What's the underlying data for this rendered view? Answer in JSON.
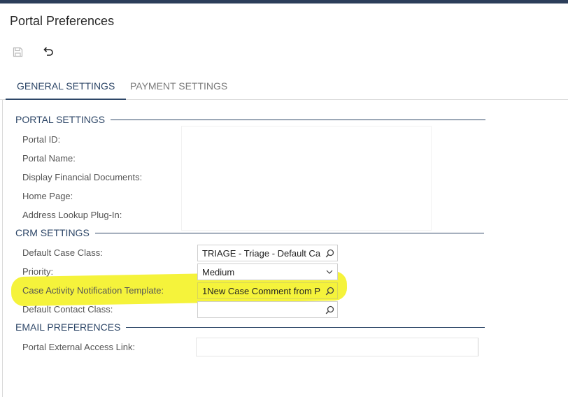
{
  "page": {
    "title": "Portal Preferences"
  },
  "toolbar": {
    "save_icon": "save-icon",
    "undo_icon": "undo-icon"
  },
  "tabs": [
    {
      "label": "GENERAL SETTINGS",
      "active": true
    },
    {
      "label": "PAYMENT SETTINGS",
      "active": false
    }
  ],
  "portal_settings": {
    "heading": "PORTAL SETTINGS",
    "labels": {
      "portal_id": "Portal ID:",
      "portal_name": "Portal Name:",
      "display_financial_documents": "Display Financial Documents:",
      "home_page": "Home Page:",
      "address_lookup_plugin": "Address Lookup Plug-In:"
    }
  },
  "crm_settings": {
    "heading": "CRM SETTINGS",
    "default_case_class": {
      "label": "Default Case Class:",
      "value": "TRIAGE - Triage - Default Ca"
    },
    "priority": {
      "label": "Priority:",
      "value": "Medium"
    },
    "case_activity_notification_template": {
      "label": "Case Activity Notification Template:",
      "value": "1New Case Comment from P"
    },
    "default_contact_class": {
      "label": "Default Contact Class:",
      "value": ""
    }
  },
  "email_preferences": {
    "heading": "EMAIL PREFERENCES",
    "portal_external_access_link": {
      "label": "Portal External Access Link:",
      "value": ""
    }
  },
  "colors": {
    "accent": "#2d4667",
    "highlight": "#f5f33b",
    "topbar": "#2c3e5a"
  }
}
